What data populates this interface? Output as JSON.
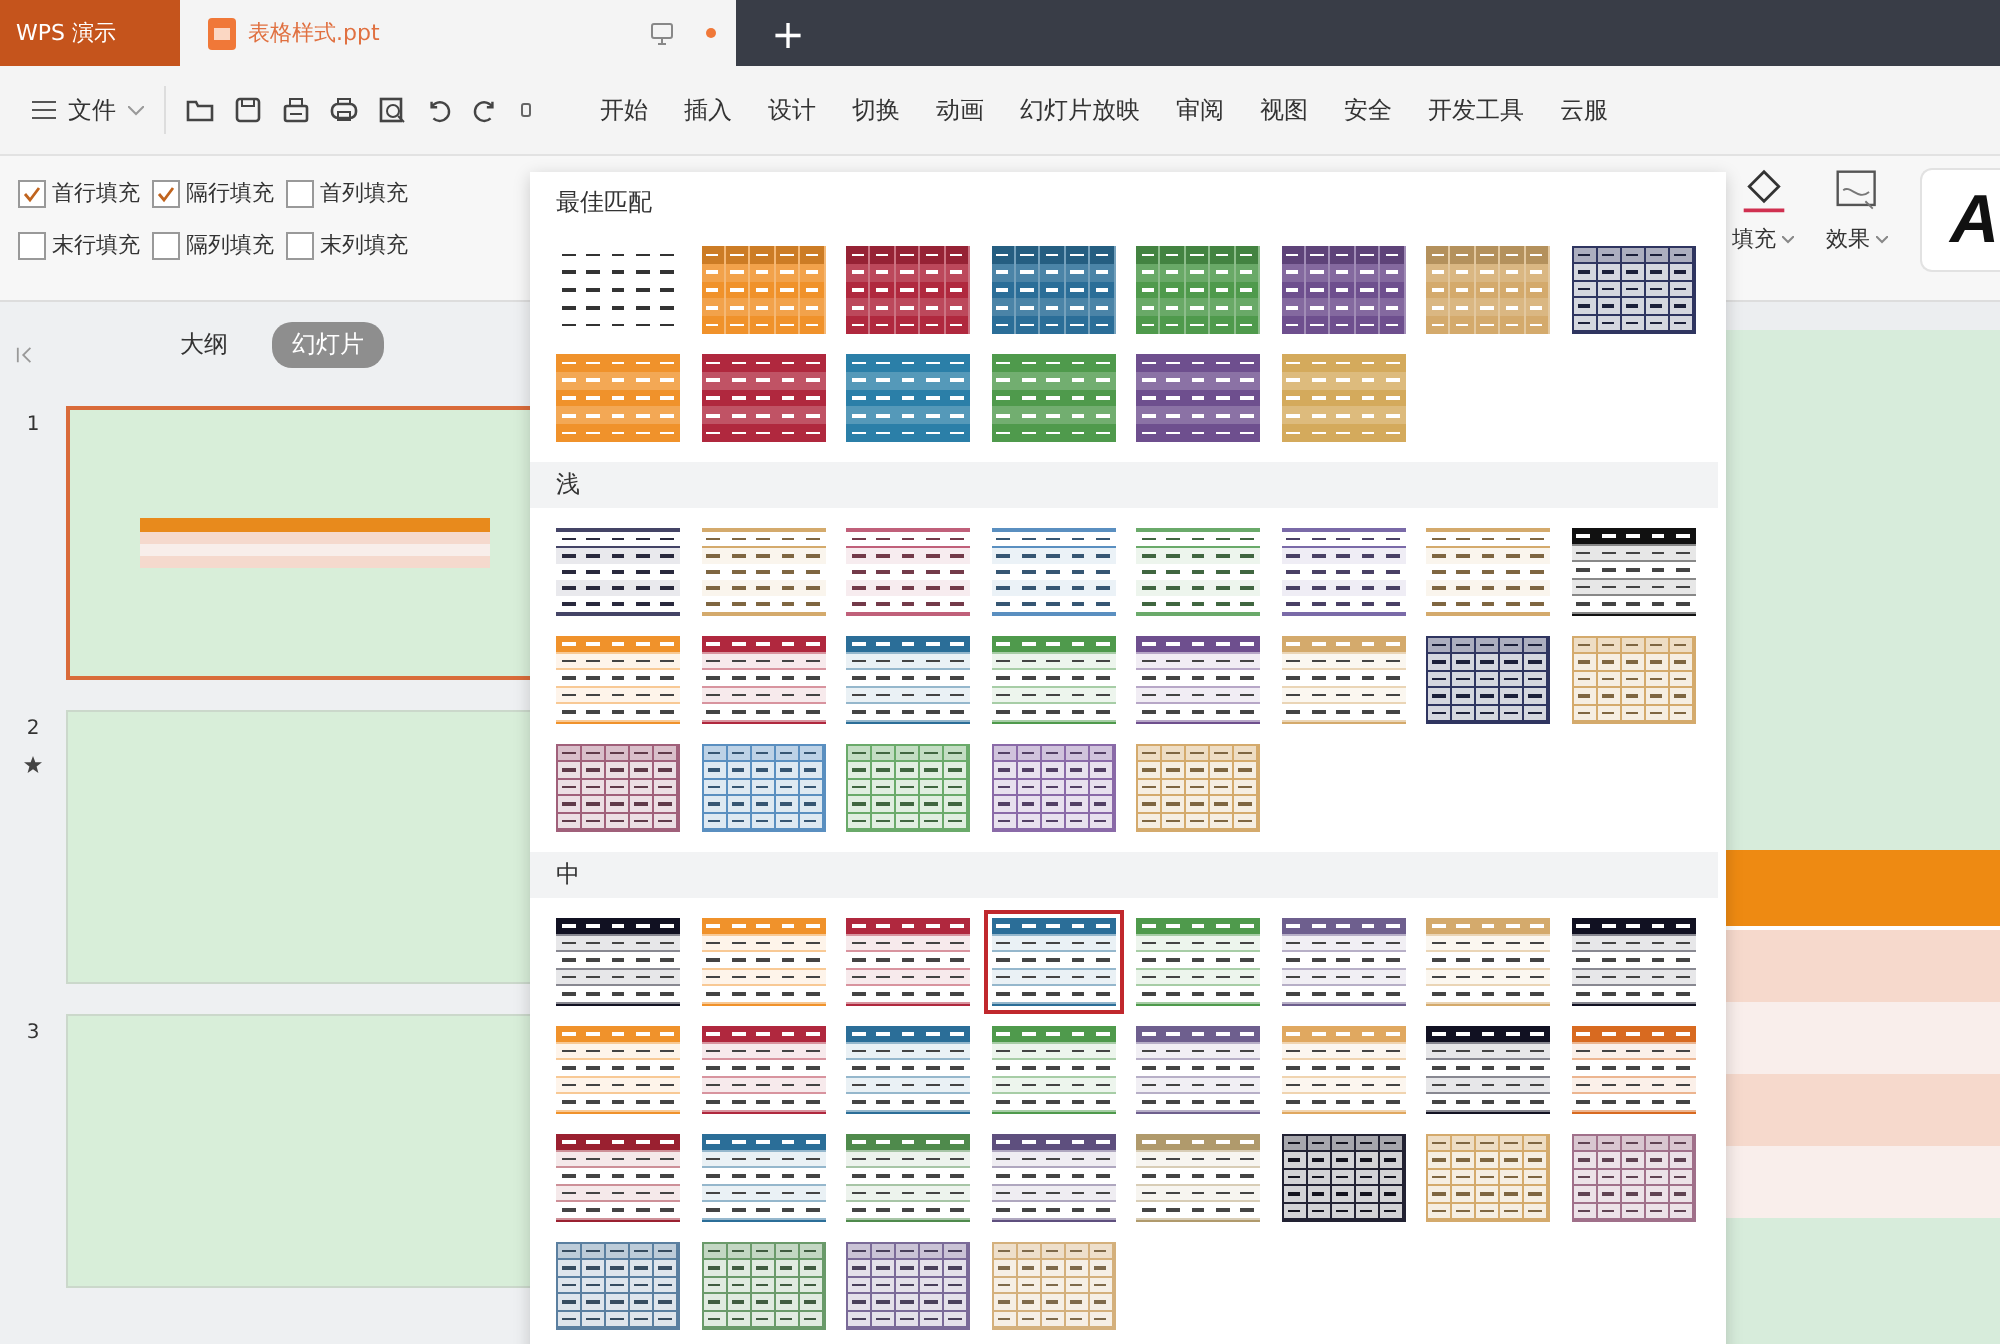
{
  "app_tab": {
    "label": "WPS 演示"
  },
  "document_tab": {
    "title": "表格样式.ppt",
    "unsaved": true
  },
  "new_tab": {
    "label": "+"
  },
  "file_menu": {
    "label": "文件"
  },
  "menu": [
    {
      "label": "开始",
      "selected": false
    },
    {
      "label": "插入",
      "selected": false
    },
    {
      "label": "设计",
      "selected": false
    },
    {
      "label": "切换",
      "selected": false
    },
    {
      "label": "动画",
      "selected": false
    },
    {
      "label": "幻灯片放映",
      "selected": false
    },
    {
      "label": "审阅",
      "selected": false
    },
    {
      "label": "视图",
      "selected": false
    },
    {
      "label": "安全",
      "selected": false
    },
    {
      "label": "开发工具",
      "selected": false
    },
    {
      "label": "云服",
      "selected": false
    }
  ],
  "table_options": [
    {
      "label": "首行填充",
      "checked": true
    },
    {
      "label": "隔行填充",
      "checked": true
    },
    {
      "label": "首列填充",
      "checked": false
    },
    {
      "label": "末行填充",
      "checked": false
    },
    {
      "label": "隔列填充",
      "checked": false
    },
    {
      "label": "末列填充",
      "checked": false
    }
  ],
  "ribbon_right": [
    {
      "label": "填充",
      "kind": "fill"
    },
    {
      "label": "效果",
      "kind": "effect"
    },
    {
      "label": "A",
      "kind": "text"
    }
  ],
  "panel_tabs": [
    {
      "label": "大纲",
      "selected": false
    },
    {
      "label": "幻灯片",
      "selected": true
    }
  ],
  "slides": [
    {
      "number": "1",
      "selected": true,
      "animated": false,
      "kind": "table"
    },
    {
      "number": "2",
      "selected": false,
      "animated": true,
      "kind": "blank"
    },
    {
      "number": "3",
      "selected": false,
      "animated": false,
      "kind": "blank"
    }
  ],
  "gallery": {
    "sections": [
      {
        "title": "最佳匹配",
        "styles": [
          {
            "kind": "plain",
            "color": "#333333",
            "selected": false
          },
          {
            "kind": "solid",
            "color": "#f0922b",
            "selected": false
          },
          {
            "kind": "solid",
            "color": "#b0283e",
            "selected": false
          },
          {
            "kind": "solid",
            "color": "#2b6e98",
            "selected": false
          },
          {
            "kind": "solid",
            "color": "#4f9a4c",
            "selected": false
          },
          {
            "kind": "solid",
            "color": "#6e4f8e",
            "selected": false
          },
          {
            "kind": "solid",
            "color": "#d4aa6c",
            "selected": false
          },
          {
            "kind": "grid",
            "color": "#2f3560",
            "selected": false
          },
          {
            "kind": "banded",
            "color": "#f0922b",
            "selected": false
          },
          {
            "kind": "banded",
            "color": "#b0283e",
            "selected": false
          },
          {
            "kind": "banded",
            "color": "#2b7fa8",
            "selected": false
          },
          {
            "kind": "banded",
            "color": "#4f9a4c",
            "selected": false
          },
          {
            "kind": "banded",
            "color": "#6e4f8e",
            "selected": false
          },
          {
            "kind": "banded",
            "color": "#d4aa5c",
            "selected": false
          }
        ]
      },
      {
        "title": "浅",
        "styles": [
          {
            "kind": "light",
            "color": "#444466",
            "selected": false
          },
          {
            "kind": "light",
            "color": "#d4aa6c",
            "selected": false
          },
          {
            "kind": "light",
            "color": "#c0607a",
            "selected": false
          },
          {
            "kind": "light",
            "color": "#5a8fc0",
            "selected": false
          },
          {
            "kind": "light",
            "color": "#6aaa6a",
            "selected": false
          },
          {
            "kind": "light",
            "color": "#7a6aa8",
            "selected": false
          },
          {
            "kind": "light",
            "color": "#d4aa6c",
            "selected": false
          },
          {
            "kind": "header",
            "color": "#111111",
            "selected": false
          },
          {
            "kind": "header",
            "color": "#f0922b",
            "selected": false
          },
          {
            "kind": "header",
            "color": "#b0283e",
            "selected": false
          },
          {
            "kind": "header",
            "color": "#2b6e98",
            "selected": false
          },
          {
            "kind": "header",
            "color": "#4f9a4c",
            "selected": false
          },
          {
            "kind": "header",
            "color": "#6e4f8e",
            "selected": false
          },
          {
            "kind": "header",
            "color": "#d4aa6c",
            "selected": false
          },
          {
            "kind": "grid",
            "color": "#2f3560",
            "selected": false
          },
          {
            "kind": "grid",
            "color": "#d4aa6c",
            "selected": false
          },
          {
            "kind": "grid",
            "color": "#a0607a",
            "selected": false
          },
          {
            "kind": "grid",
            "color": "#5a8fc0",
            "selected": false
          },
          {
            "kind": "grid",
            "color": "#6aaa6a",
            "selected": false
          },
          {
            "kind": "grid",
            "color": "#8a6aa8",
            "selected": false
          },
          {
            "kind": "grid",
            "color": "#d4aa6c",
            "selected": false
          }
        ]
      },
      {
        "title": "中",
        "styles": [
          {
            "kind": "header",
            "color": "#111122",
            "selected": false
          },
          {
            "kind": "header",
            "color": "#f0922b",
            "selected": false
          },
          {
            "kind": "header",
            "color": "#b0283e",
            "selected": false
          },
          {
            "kind": "header",
            "color": "#2b6e98",
            "selected": true
          },
          {
            "kind": "header",
            "color": "#4f9a4c",
            "selected": false
          },
          {
            "kind": "header",
            "color": "#6e5f8e",
            "selected": false
          },
          {
            "kind": "header",
            "color": "#d4aa6c",
            "selected": false
          },
          {
            "kind": "header",
            "color": "#111122",
            "selected": false
          },
          {
            "kind": "header",
            "color": "#f0922b",
            "selected": false
          },
          {
            "kind": "header",
            "color": "#b0283e",
            "selected": false
          },
          {
            "kind": "header",
            "color": "#2b6e98",
            "selected": false
          },
          {
            "kind": "header",
            "color": "#4f9a4c",
            "selected": false
          },
          {
            "kind": "header",
            "color": "#6e5f8e",
            "selected": false
          },
          {
            "kind": "header",
            "color": "#e0a860",
            "selected": false
          },
          {
            "kind": "header",
            "color": "#111122",
            "selected": false
          },
          {
            "kind": "header",
            "color": "#d86a20",
            "selected": false
          },
          {
            "kind": "header",
            "color": "#9a2030",
            "selected": false
          },
          {
            "kind": "header",
            "color": "#2b6e98",
            "selected": false
          },
          {
            "kind": "header",
            "color": "#4f8a4c",
            "selected": false
          },
          {
            "kind": "header",
            "color": "#5e4f7e",
            "selected": false
          },
          {
            "kind": "header",
            "color": "#b09a6c",
            "selected": false
          },
          {
            "kind": "grid",
            "color": "#222233",
            "selected": false
          },
          {
            "kind": "grid",
            "color": "#d4aa6c",
            "selected": false
          },
          {
            "kind": "grid",
            "color": "#a0708a",
            "selected": false
          },
          {
            "kind": "grid",
            "color": "#5a7fa0",
            "selected": false
          },
          {
            "kind": "grid",
            "color": "#6a9a6a",
            "selected": false
          },
          {
            "kind": "grid",
            "color": "#7a6a98",
            "selected": false
          },
          {
            "kind": "grid",
            "color": "#d4b07c",
            "selected": false
          }
        ]
      }
    ]
  }
}
